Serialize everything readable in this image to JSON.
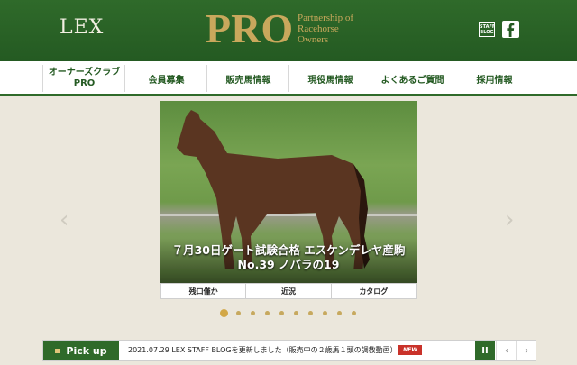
{
  "header": {
    "lex_logo": "LEX",
    "pro_logo": "PRO",
    "tagline": [
      "Partnership of",
      "Racehorse",
      "Owners"
    ],
    "staff_blog_label": "STAFF BLOG",
    "facebook_icon": "facebook-icon"
  },
  "nav": {
    "items": [
      {
        "label": "オーナーズクラブ",
        "sub": "PRO"
      },
      {
        "label": "会員募集"
      },
      {
        "label": "販売馬情報"
      },
      {
        "label": "現役馬情報"
      },
      {
        "label": "よくあるご質問"
      },
      {
        "label": "採用情報"
      }
    ]
  },
  "slideshow": {
    "caption_line1": "７月30日ゲート試験合格 エスケンデレヤ産駒",
    "caption_line2": "No.39 ノバラの19",
    "links": [
      "残口僅か",
      "近況",
      "カタログ"
    ],
    "dot_count": 10,
    "active_dot": 0
  },
  "pickup": {
    "label": "Pick up",
    "news": "2021.07.29 LEX STAFF BLOGを更新しました（販売中の２歳馬１頭の調教動画）",
    "badge": "NEW",
    "pause": "II",
    "prev": "‹",
    "next": "›"
  }
}
